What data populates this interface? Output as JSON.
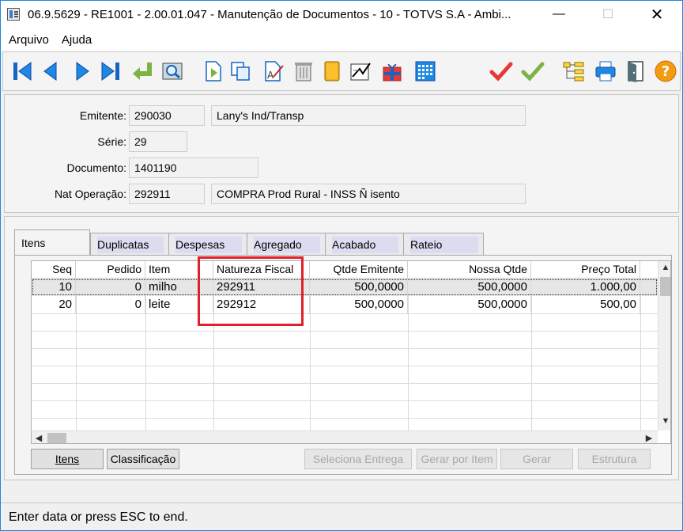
{
  "window": {
    "title": "06.9.5629 - RE1001 - 2.00.01.047 - Manutenção de Documentos - 10 - TOTVS S.A - Ambi...",
    "minimize": "—",
    "maximize": "☐",
    "close": "✕"
  },
  "menu": {
    "items": [
      {
        "label": "Arquivo"
      },
      {
        "label": "Ajuda"
      }
    ]
  },
  "header": {
    "emitente_label": "Emitente:",
    "emitente_code": "290030",
    "emitente_name": "Lany's Ind/Transp",
    "serie_label": "Série:",
    "serie_value": "29",
    "documento_label": "Documento:",
    "documento_value": "1401190",
    "natop_label": "Nat Operação:",
    "natop_code": "292911",
    "natop_desc": "COMPRA Prod Rural - INSS Ñ isento"
  },
  "tabs": [
    {
      "label": "Itens"
    },
    {
      "label": "Duplicatas"
    },
    {
      "label": "Despesas"
    },
    {
      "label": "Agregado"
    },
    {
      "label": "Acabado"
    },
    {
      "label": "Rateio"
    }
  ],
  "grid": {
    "columns": [
      "Seq",
      "Pedido",
      "Item",
      "Natureza Fiscal",
      "Qtde Emitente",
      "Nossa Qtde",
      "Preço Total"
    ],
    "rows": [
      {
        "seq": "10",
        "pedido": "0",
        "item": "milho",
        "natureza": "292911",
        "qtde_emitente": "500,0000",
        "nossa_qtde": "500,0000",
        "preco_total": "1.000,00"
      },
      {
        "seq": "20",
        "pedido": "0",
        "item": "leite",
        "natureza": "292912",
        "qtde_emitente": "500,0000",
        "nossa_qtde": "500,0000",
        "preco_total": "500,00"
      }
    ]
  },
  "buttons": {
    "itens": "Itens",
    "classificacao": "Classificação",
    "seleciona_entrega": "Seleciona Entrega",
    "gerar_por_item": "Gerar por Item",
    "gerar": "Gerar",
    "estrutura": "Estrutura"
  },
  "status": {
    "text": "Enter data or press ESC to end."
  },
  "icons": {
    "accent_blue": "#1565c0",
    "confirm_red": "#e53935",
    "confirm_green": "#43a047",
    "help_orange": "#f39c12"
  }
}
